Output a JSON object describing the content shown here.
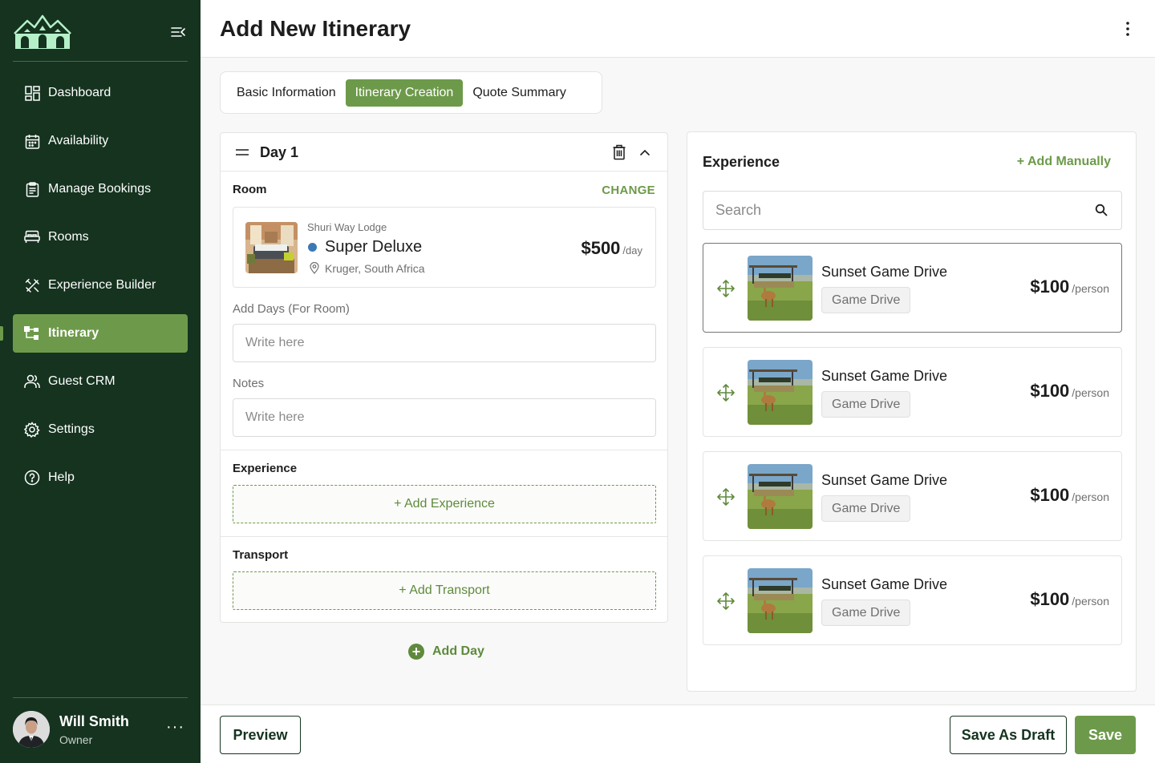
{
  "header": {
    "title": "Add New Itinerary"
  },
  "sidebar": {
    "items": [
      {
        "label": "Dashboard",
        "icon": "dashboard-icon"
      },
      {
        "label": "Availability",
        "icon": "calendar-icon"
      },
      {
        "label": "Manage Bookings",
        "icon": "clipboard-icon"
      },
      {
        "label": "Rooms",
        "icon": "bed-icon"
      },
      {
        "label": "Experience Builder",
        "icon": "tools-icon"
      },
      {
        "label": "Itinerary",
        "icon": "hierarchy-icon",
        "active": true
      },
      {
        "label": "Guest CRM",
        "icon": "users-icon"
      },
      {
        "label": "Settings",
        "icon": "gear-icon"
      },
      {
        "label": "Help",
        "icon": "help-icon"
      }
    ],
    "user": {
      "name": "Will Smith",
      "role": "Owner"
    }
  },
  "tabs": [
    {
      "label": "Basic Information",
      "active": false
    },
    {
      "label": "Itinerary Creation",
      "active": true
    },
    {
      "label": "Quote Summary",
      "active": false
    }
  ],
  "day": {
    "title": "Day 1",
    "room_label": "Room",
    "change_label": "CHANGE",
    "room": {
      "lodge": "Shuri Way Lodge",
      "name": "Super Deluxe",
      "location": "Kruger, South Africa",
      "price": "$500",
      "price_unit": "/day"
    },
    "add_days_label": "Add Days (For Room)",
    "add_days_placeholder": "Write here",
    "notes_label": "Notes",
    "notes_placeholder": "Write here",
    "experience_label": "Experience",
    "add_experience": "+ Add Experience",
    "transport_label": "Transport",
    "add_transport": "+ Add Transport"
  },
  "add_day": "Add Day",
  "experience_panel": {
    "title": "Experience",
    "add_manually": "+ Add Manually",
    "search_placeholder": "Search",
    "items": [
      {
        "name": "Sunset Game Drive",
        "tag": "Game Drive",
        "price": "$100",
        "unit": "/person",
        "selected": true
      },
      {
        "name": "Sunset Game Drive",
        "tag": "Game Drive",
        "price": "$100",
        "unit": "/person",
        "selected": false
      },
      {
        "name": "Sunset Game Drive",
        "tag": "Game Drive",
        "price": "$100",
        "unit": "/person",
        "selected": false
      },
      {
        "name": "Sunset Game Drive",
        "tag": "Game Drive",
        "price": "$100",
        "unit": "/person",
        "selected": false
      }
    ]
  },
  "footer": {
    "preview": "Preview",
    "save_draft": "Save As Draft",
    "save": "Save"
  },
  "colors": {
    "sidebar_bg": "#15331f",
    "accent": "#6d9a4a",
    "room_dot": "#3c78b5"
  }
}
